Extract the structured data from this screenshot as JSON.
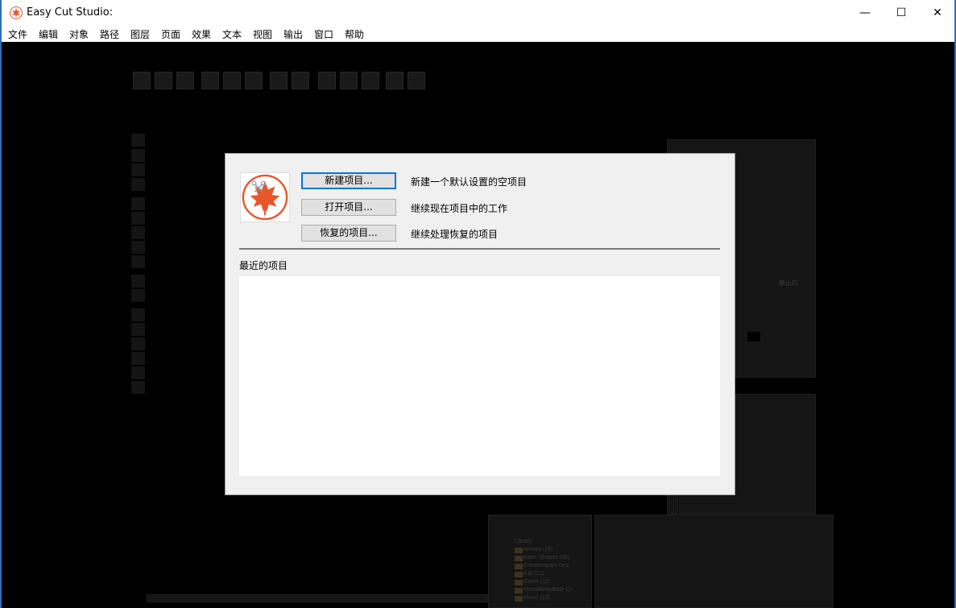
{
  "window": {
    "title": "Easy Cut Studio:",
    "minimize_glyph": "—",
    "maximize_glyph": "☐",
    "close_glyph": "✕"
  },
  "menu": [
    "文件",
    "编辑",
    "对象",
    "路径",
    "图层",
    "页面",
    "效果",
    "文本",
    "视图",
    "输出",
    "窗口",
    "帮助"
  ],
  "dialog": {
    "buttons": [
      {
        "label": "新建项目...",
        "description": "新建一个默认设置的空项目"
      },
      {
        "label": "打开项目...",
        "description": "继续现在项目中的工作"
      },
      {
        "label": "恢复的项目...",
        "description": "继续处理恢复的项目"
      }
    ],
    "recent_label": "最近的项目",
    "recent_items": []
  },
  "background": {
    "library_items": [
      "Library",
      "Arrows (18)",
      "Basic Shapes (96)",
      "Createnspani Ons",
      "Fall (12)",
      "Game (12)",
      "NortalBeNoBale Cn",
      "Music (10)"
    ],
    "panel_hint": "静止的"
  },
  "colors": {
    "accent": "#0078d7",
    "logo": "#e8572a",
    "dialog_bg": "#f0f0f0"
  }
}
